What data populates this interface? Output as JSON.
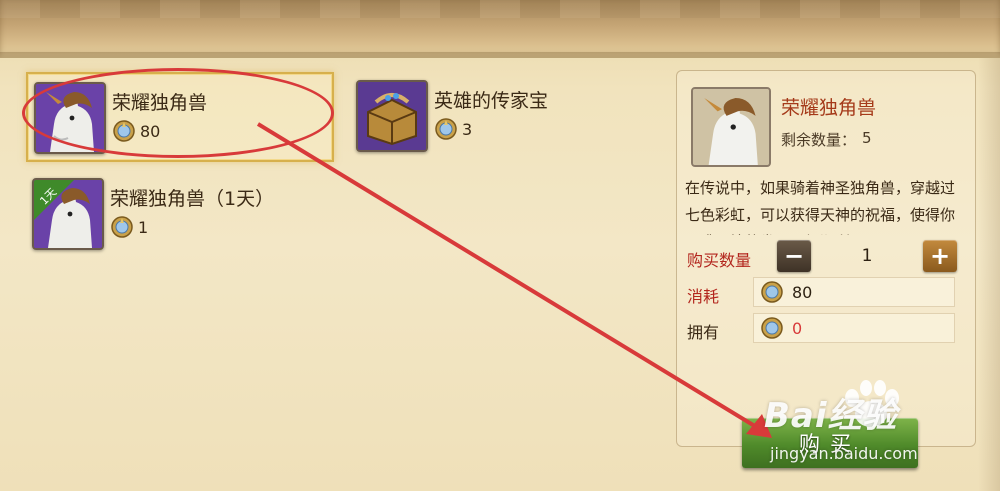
{
  "shop_items": [
    {
      "name": "荣耀独角兽",
      "price": "80",
      "icon": "unicorn-icon",
      "badge": ""
    },
    {
      "name": "英雄的传家宝",
      "price": "3",
      "icon": "treasure-chest-icon",
      "badge": ""
    },
    {
      "name": "荣耀独角兽（1天）",
      "price": "1",
      "icon": "unicorn-icon",
      "badge": "1天"
    }
  ],
  "detail": {
    "name": "荣耀独角兽",
    "remaining_label": "剩余数量：",
    "remaining_value": "5",
    "description": "在传说中，如果骑着神圣独角兽，穿越过七色彩虹，可以获得天神的祝福，使得你周遭环境的发展更加顺利",
    "quantity_label": "购买数量",
    "quantity_value": "1",
    "minus_label": "−",
    "plus_label": "+",
    "cost_label": "消耗",
    "cost_value": "80",
    "own_label": "拥有",
    "own_value": "0"
  },
  "buy_label": "购买",
  "watermark": {
    "title": "Bai经验",
    "subtitle": "jingyan.baidu.com"
  },
  "colors": {
    "accent_red": "#d83a3a",
    "detail_title": "#a53a1a",
    "label_red": "#b3261e",
    "buy_green": "#4f8a2a",
    "selection_gold": "#d7b04c"
  }
}
